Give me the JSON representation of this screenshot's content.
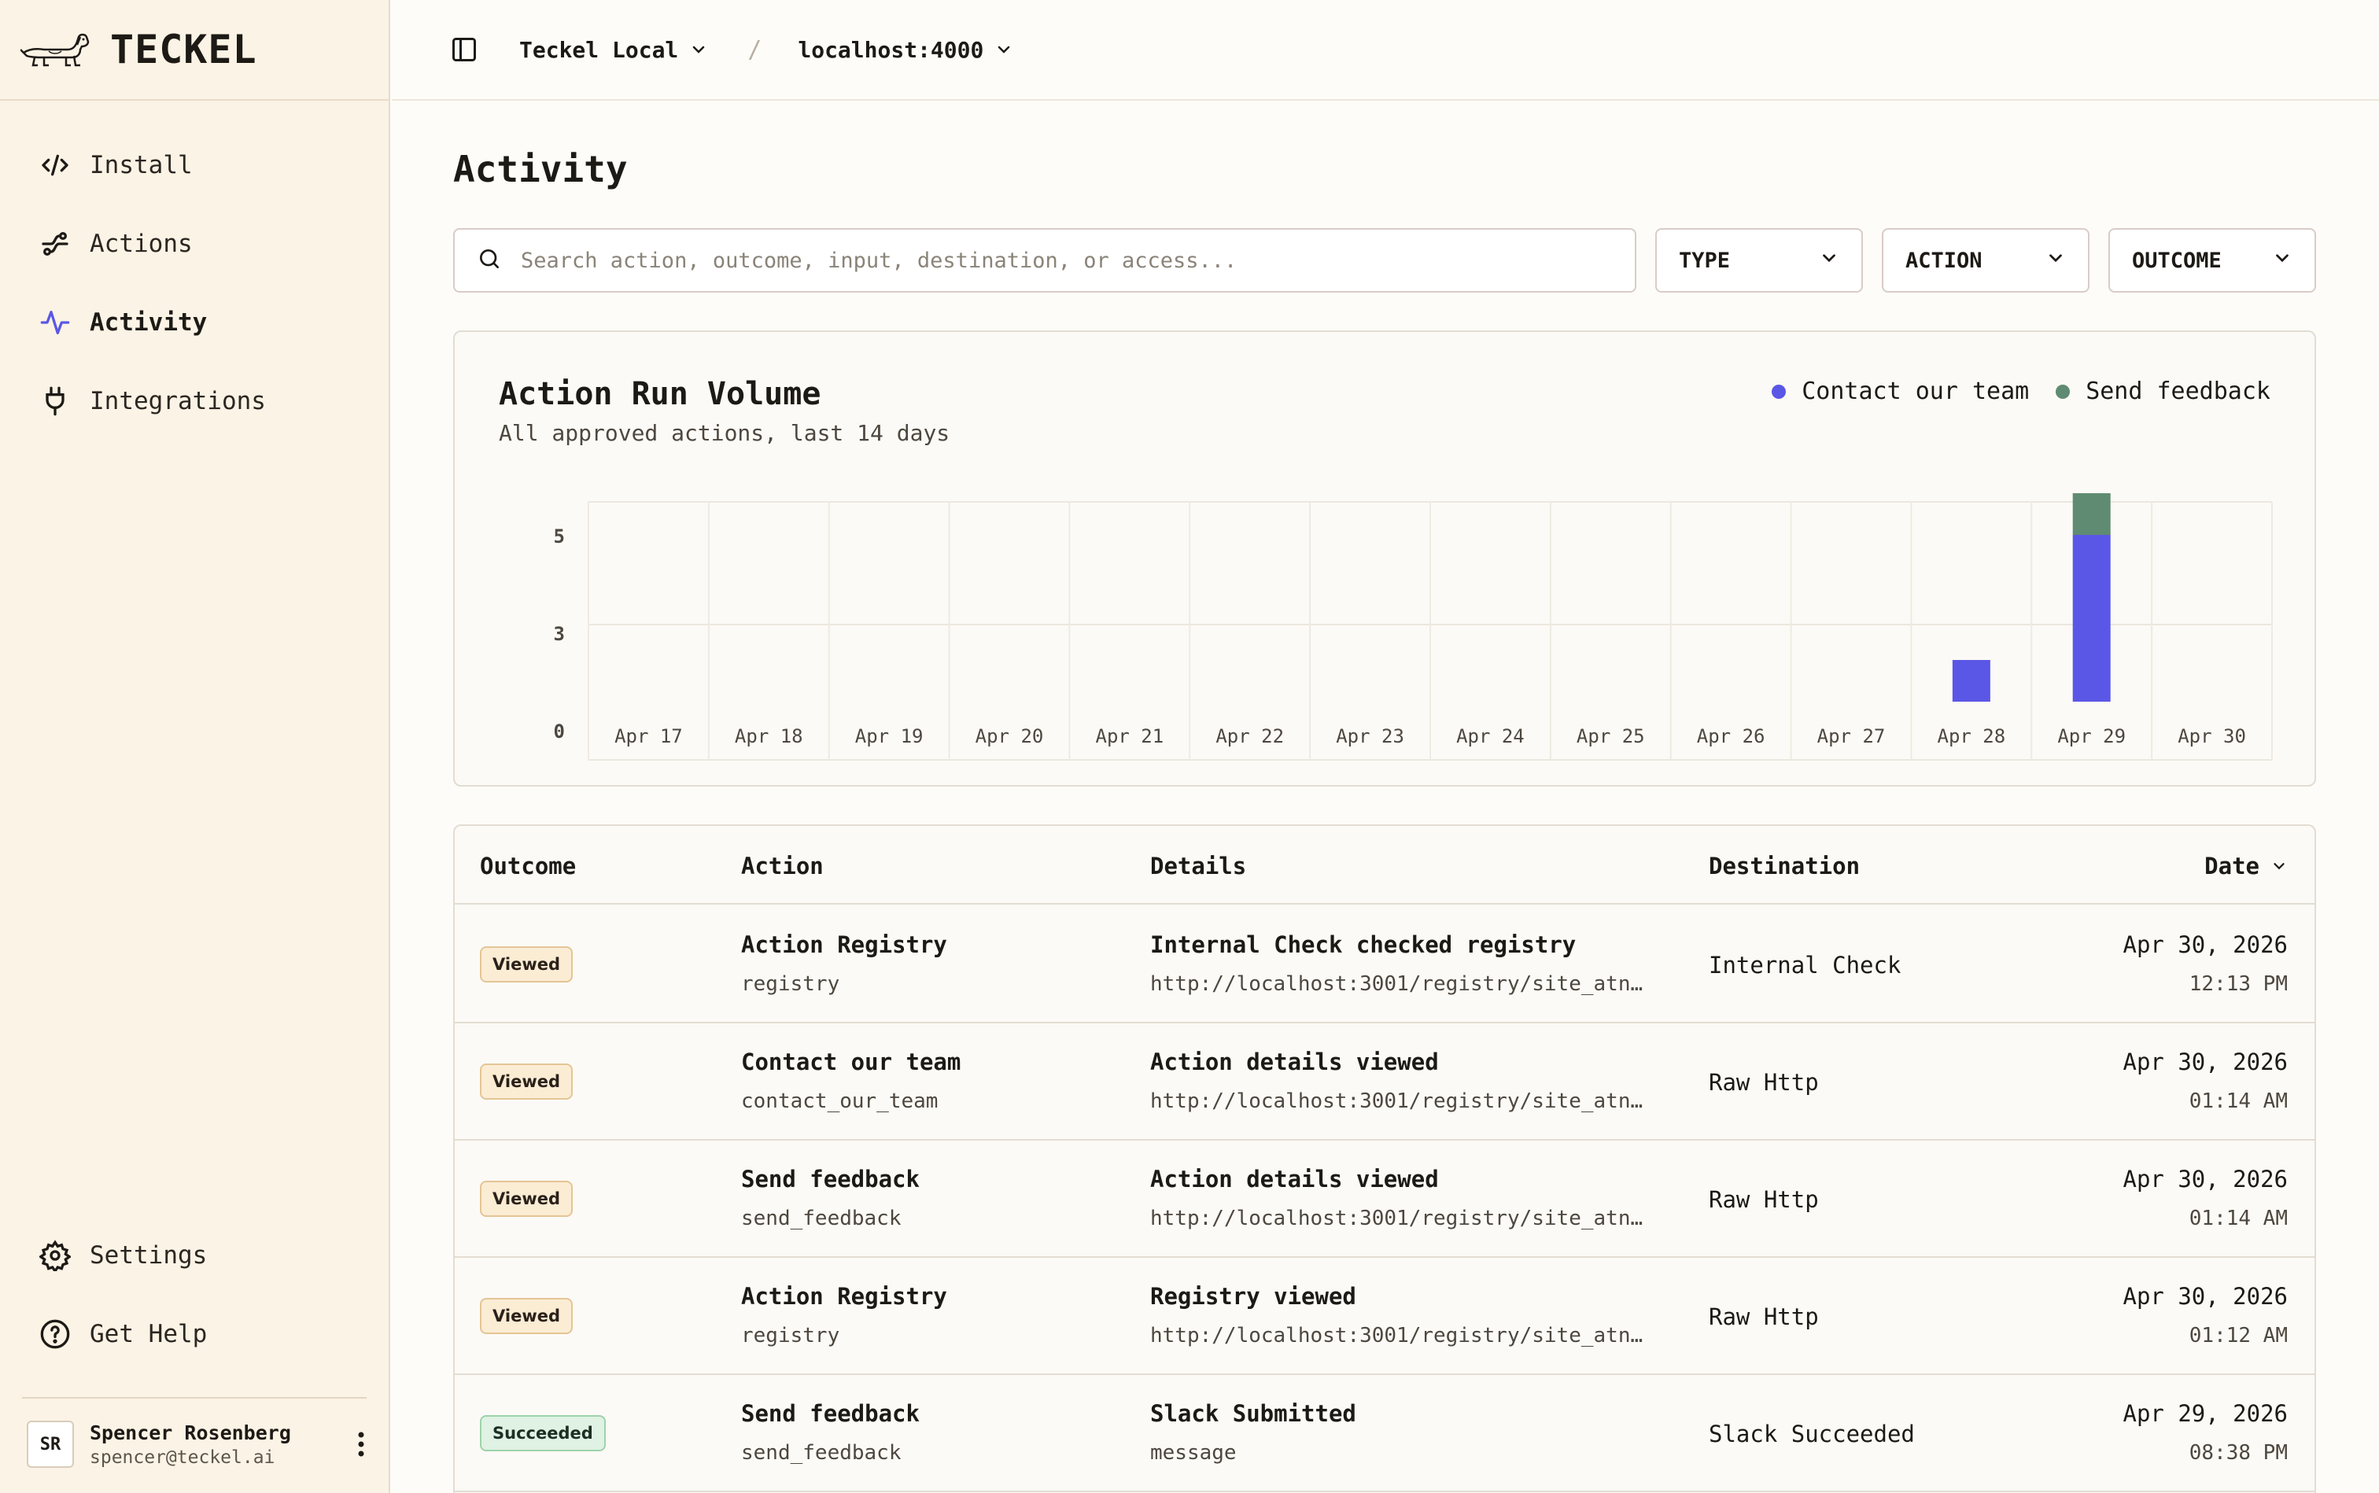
{
  "brand": {
    "name": "TECKEL"
  },
  "sidebar": {
    "items": [
      {
        "label": "Install",
        "icon": "code-icon"
      },
      {
        "label": "Actions",
        "icon": "route-icon"
      },
      {
        "label": "Activity",
        "icon": "activity-icon",
        "active": true
      },
      {
        "label": "Integrations",
        "icon": "plug-icon"
      }
    ],
    "bottom": [
      {
        "label": "Settings",
        "icon": "gear-icon"
      },
      {
        "label": "Get Help",
        "icon": "help-circle-icon"
      }
    ],
    "user": {
      "initials": "SR",
      "name": "Spencer Rosenberg",
      "email": "spencer@teckel.ai"
    }
  },
  "topbar": {
    "workspace": "Teckel Local",
    "separator": "/",
    "environment": "localhost:4000"
  },
  "main": {
    "title": "Activity",
    "search_placeholder": "Search action, outcome, input, destination, or access...",
    "filters": [
      "TYPE",
      "ACTION",
      "OUTCOME"
    ]
  },
  "colors": {
    "accent": "#5b57e6",
    "series_contact": "#5b57e6",
    "series_feedback": "#5f8b72"
  },
  "chart_data": {
    "type": "bar",
    "stacked": true,
    "title": "Action Run Volume",
    "subtitle": "All approved actions, last 14 days",
    "categories": [
      "Apr 17",
      "Apr 18",
      "Apr 19",
      "Apr 20",
      "Apr 21",
      "Apr 22",
      "Apr 23",
      "Apr 24",
      "Apr 25",
      "Apr 26",
      "Apr 27",
      "Apr 28",
      "Apr 29",
      "Apr 30"
    ],
    "series": [
      {
        "name": "Contact our team",
        "color": "#5b57e6",
        "values": [
          0,
          0,
          0,
          0,
          0,
          0,
          0,
          0,
          0,
          0,
          0,
          1,
          4,
          0
        ]
      },
      {
        "name": "Send feedback",
        "color": "#5f8b72",
        "values": [
          0,
          0,
          0,
          0,
          0,
          0,
          0,
          0,
          0,
          0,
          0,
          0,
          1,
          0
        ]
      }
    ],
    "yticks": [
      0,
      3,
      5
    ],
    "ylim": [
      0,
      6
    ],
    "legend_position": "top-right",
    "grid": true
  },
  "table": {
    "headers": {
      "outcome": "Outcome",
      "action": "Action",
      "details": "Details",
      "destination": "Destination",
      "date": "Date"
    },
    "rows": [
      {
        "outcome": "Viewed",
        "outcome_kind": "viewed",
        "action": "Action Registry",
        "action_id": "registry",
        "detail": "Internal Check checked registry",
        "detail_sub": "http://localhost:3001/registry/site_atnm…",
        "destination": "Internal Check",
        "date": "Apr 30, 2026",
        "time": "12:13 PM"
      },
      {
        "outcome": "Viewed",
        "outcome_kind": "viewed",
        "action": "Contact our team",
        "action_id": "contact_our_team",
        "detail": "Action details viewed",
        "detail_sub": "http://localhost:3001/registry/site_atnm…",
        "destination": "Raw Http",
        "date": "Apr 30, 2026",
        "time": "01:14 AM"
      },
      {
        "outcome": "Viewed",
        "outcome_kind": "viewed",
        "action": "Send feedback",
        "action_id": "send_feedback",
        "detail": "Action details viewed",
        "detail_sub": "http://localhost:3001/registry/site_atnm…",
        "destination": "Raw Http",
        "date": "Apr 30, 2026",
        "time": "01:14 AM"
      },
      {
        "outcome": "Viewed",
        "outcome_kind": "viewed",
        "action": "Action Registry",
        "action_id": "registry",
        "detail": "Registry viewed",
        "detail_sub": "http://localhost:3001/registry/site_atnm…",
        "destination": "Raw Http",
        "date": "Apr 30, 2026",
        "time": "01:12 AM"
      },
      {
        "outcome": "Succeeded",
        "outcome_kind": "succeeded",
        "action": "Send feedback",
        "action_id": "send_feedback",
        "detail": "Slack Submitted",
        "detail_sub": "message",
        "destination": "Slack Succeeded",
        "date": "Apr 29, 2026",
        "time": "08:38 PM"
      }
    ]
  }
}
